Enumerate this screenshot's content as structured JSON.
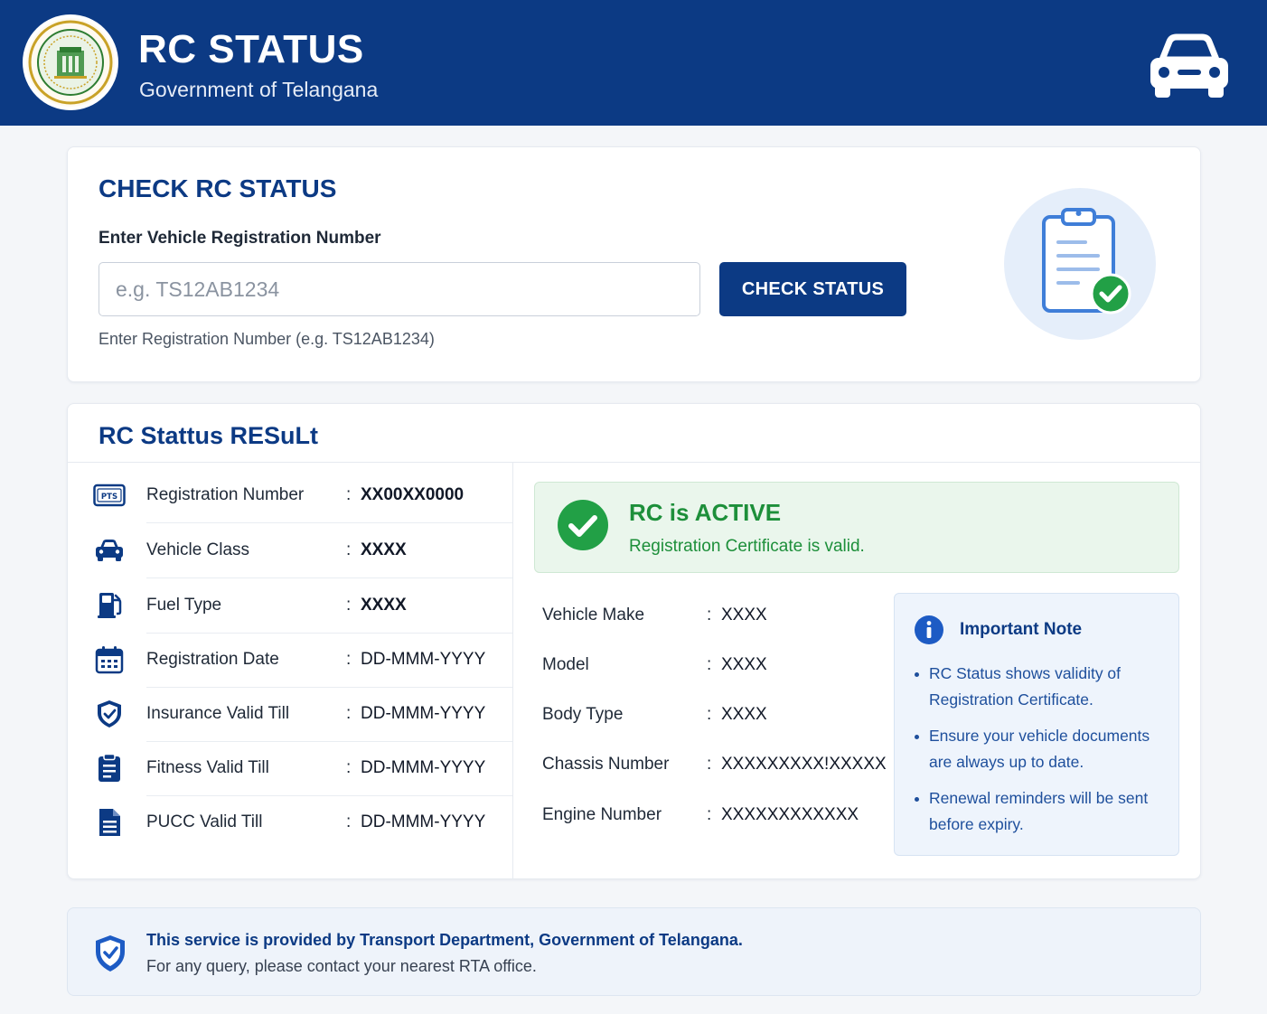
{
  "header": {
    "title": "RC STATUS",
    "subtitle": "Government of Telangana",
    "logo_icon": "telangana-emblem",
    "car_icon": "car-icon"
  },
  "check": {
    "title": "CHECK RC STATUS",
    "field_label": "Enter Vehicle Registration Number",
    "input_value": "",
    "input_placeholder": "e.g. TS12AB1234",
    "button_label": "CHECK STATUS",
    "hint": "Enter Registration Number (e.g. TS12AB1234)",
    "illustration_icon": "clipboard-check-icon"
  },
  "result": {
    "title": "RC Stattus RESuLt",
    "details": [
      {
        "icon": "license-plate-icon",
        "label": "Registration Number",
        "value": "XX00XX0000"
      },
      {
        "icon": "car-front-icon",
        "label": "Vehicle Class",
        "value": "XXXX"
      },
      {
        "icon": "fuel-pump-icon",
        "label": "Fuel Type",
        "value": "XXXX"
      },
      {
        "icon": "calendar-icon",
        "label": "Registration Date",
        "value": "DD-MMM-YYYY"
      },
      {
        "icon": "shield-check-icon",
        "label": "Insurance Valid Till",
        "value": "DD-MMM-YYYY"
      },
      {
        "icon": "clipboard-icon",
        "label": "Fitness Valid Till",
        "value": "DD-MMM-YYYY"
      },
      {
        "icon": "document-icon",
        "label": "PUCC Valid Till",
        "value": "DD-MMM-YYYY"
      }
    ],
    "status": {
      "title": "RC is ACTIVE",
      "subtitle": "Registration Certificate is valid.",
      "color": "#1d8f3a"
    },
    "specs": [
      {
        "label": "Vehicle Make",
        "value": "XXXX"
      },
      {
        "label": "Model",
        "value": "XXXX"
      },
      {
        "label": "Body Type",
        "value": "XXXX"
      },
      {
        "label": "Chassis Number",
        "value": "XXXXXXXXX!XXXXX"
      },
      {
        "label": "Engine Number",
        "value": "XXXXXXXXXXXX"
      }
    ],
    "note": {
      "title": "Important Note",
      "items": [
        "RC Status shows validity of Registration Certificate.",
        "Ensure your vehicle documents are always up to date.",
        "Renewal reminders will be sent before expiry."
      ]
    }
  },
  "footer": {
    "line1": "This service is provided by Transport Department, Government of Telangana.",
    "line2": "For any query, please contact your nearest RTA office."
  },
  "colors": {
    "primary": "#0c3a84",
    "success": "#1d8f3a",
    "background": "#f4f6f9"
  }
}
